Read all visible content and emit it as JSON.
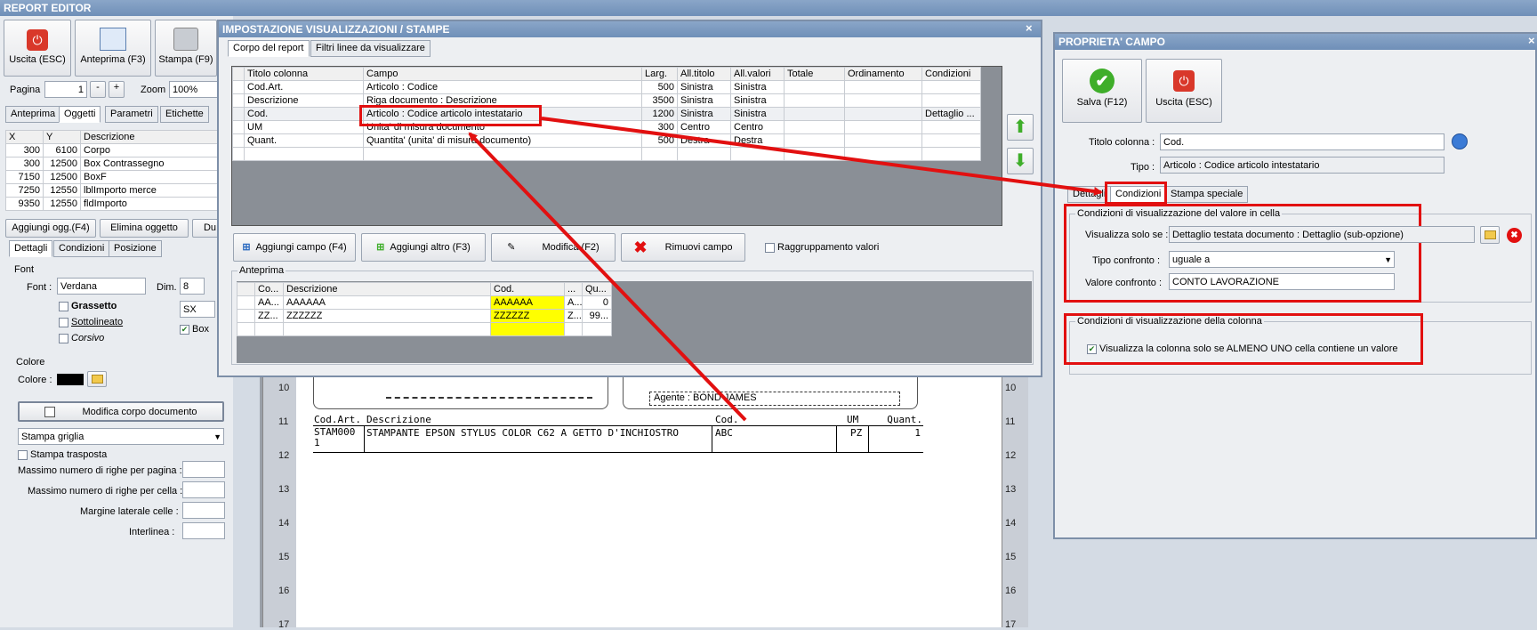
{
  "app": {
    "title": "REPORT EDITOR",
    "toolbar": {
      "exit": "Uscita (ESC)",
      "preview": "Anteprima (F3)",
      "print": "Stampa (F9)"
    },
    "page_label": "Pagina",
    "page_value": "1",
    "minus": "-",
    "plus": "+",
    "zoom_label": "Zoom",
    "zoom_value": "100%",
    "tabs": [
      "Anteprima",
      "Oggetti",
      "Parametri",
      "Etichette"
    ],
    "objects_table": {
      "headers": [
        "X",
        "Y",
        "Descrizione"
      ],
      "rows": [
        [
          "300",
          "6100",
          "Corpo"
        ],
        [
          "300",
          "12500",
          "Box Contrassegno"
        ],
        [
          "7150",
          "12500",
          "BoxF"
        ],
        [
          "7250",
          "12550",
          "lblImporto merce"
        ],
        [
          "9350",
          "12550",
          "fldImporto"
        ]
      ]
    },
    "obj_buttons": {
      "add": "Aggiungi ogg.(F4)",
      "delete": "Elimina oggetto",
      "dup": "Du"
    },
    "sub_tabs": [
      "Dettagli",
      "Condizioni",
      "Posizione"
    ],
    "font": {
      "group": "Font",
      "font_label": "Font :",
      "font_value": "Verdana",
      "dim_label": "Dim.",
      "dim_value": "8",
      "bold": "Grassetto",
      "underline": "Sottolineato",
      "italic": "Corsivo",
      "align": "SX",
      "box_label": "Box"
    },
    "color": {
      "group": "Colore",
      "label": "Colore :"
    },
    "modify_body": "Modifica corpo documento",
    "grid_select": "Stampa griglia",
    "transposed": "Stampa trasposta",
    "max_rows_page": "Massimo numero di righe per pagina :",
    "max_rows_cell": "Massimo numero di righe per cella :",
    "side_margin": "Margine laterale celle :",
    "line_spacing": "Interlinea :"
  },
  "document": {
    "ruler_numbers": [
      "10",
      "11",
      "12",
      "13",
      "14",
      "15",
      "16",
      "17"
    ],
    "agent_text": "Agente : BOND JAMES",
    "headers": [
      "Cod.Art.",
      "Descrizione",
      "Cod.",
      "UM",
      "Quant."
    ],
    "row": [
      "STAM000 1",
      "STAMPANTE EPSON STYLUS COLOR C62 A GETTO D'INCHIOSTRO",
      "ABC",
      "PZ",
      "1"
    ]
  },
  "dialog": {
    "title": "IMPOSTAZIONE VISUALIZZAZIONI / STAMPE",
    "close": "×",
    "tabs": [
      "Corpo del report",
      "Filtri linee da visualizzare"
    ],
    "columns_table": {
      "headers": [
        "Titolo colonna",
        "Campo",
        "Larg.",
        "All.titolo",
        "All.valori",
        "Totale",
        "Ordinamento",
        "Condizioni"
      ],
      "rows": [
        [
          "Cod.Art.",
          "Articolo : Codice",
          "500",
          "Sinistra",
          "Sinistra",
          "",
          "",
          ""
        ],
        [
          "Descrizione",
          "Riga documento : Descrizione",
          "3500",
          "Sinistra",
          "Sinistra",
          "",
          "",
          ""
        ],
        [
          "Cod.",
          "Articolo : Codice articolo intestatario",
          "1200",
          "Sinistra",
          "Sinistra",
          "",
          "",
          "Dettaglio ..."
        ],
        [
          "UM",
          "Unita' di misura documento",
          "300",
          "Centro",
          "Centro",
          "",
          "",
          ""
        ],
        [
          "Quant.",
          "Quantita' (unita' di misura documento)",
          "500",
          "Destra",
          "Destra",
          "",
          "",
          ""
        ]
      ]
    },
    "buttons": {
      "add_field": "Aggiungi campo (F4)",
      "add_other": "Aggiungi altro (F3)",
      "modify": "Modifica (F2)",
      "remove": "Rimuovi campo"
    },
    "grouping": "Raggruppamento valori",
    "preview_group": "Anteprima",
    "preview_table": {
      "headers": [
        "Co...",
        "Descrizione",
        "Cod.",
        "...",
        "Qu..."
      ],
      "rows": [
        [
          "AA...",
          "AAAAAA",
          "AAAAAA",
          "A...",
          "0"
        ],
        [
          "ZZ...",
          "ZZZZZZ",
          "ZZZZZZ",
          "Z...",
          "99..."
        ]
      ]
    }
  },
  "props": {
    "title": "PROPRIETA' CAMPO",
    "close": "×",
    "save": "Salva (F12)",
    "exit": "Uscita (ESC)",
    "col_title_label": "Titolo colonna :",
    "col_title_value": "Cod.",
    "type_label": "Tipo :",
    "type_value": "Articolo : Codice articolo intestatario",
    "tabs": [
      "Dettagli",
      "Condizioni",
      "Stampa speciale"
    ],
    "cell_group": "Condizioni di visualizzazione del valore in cella",
    "show_if_label": "Visualizza solo se :",
    "show_if_value": "Dettaglio testata documento : Dettaglio (sub-opzione)",
    "compare_type_label": "Tipo confronto :",
    "compare_type_value": "uguale a",
    "compare_value_label": "Valore confronto :",
    "compare_value": "CONTO LAVORAZIONE",
    "col_group": "Condizioni di visualizzazione della colonna",
    "col_check": "Visualizza la colonna solo se ALMENO UNO cella contiene un valore"
  },
  "colors": {
    "highlight_red": "#e21010",
    "preview_yellow": "#ffff00",
    "accent_red": "#d9382a",
    "accent_green": "#3fae2a"
  }
}
